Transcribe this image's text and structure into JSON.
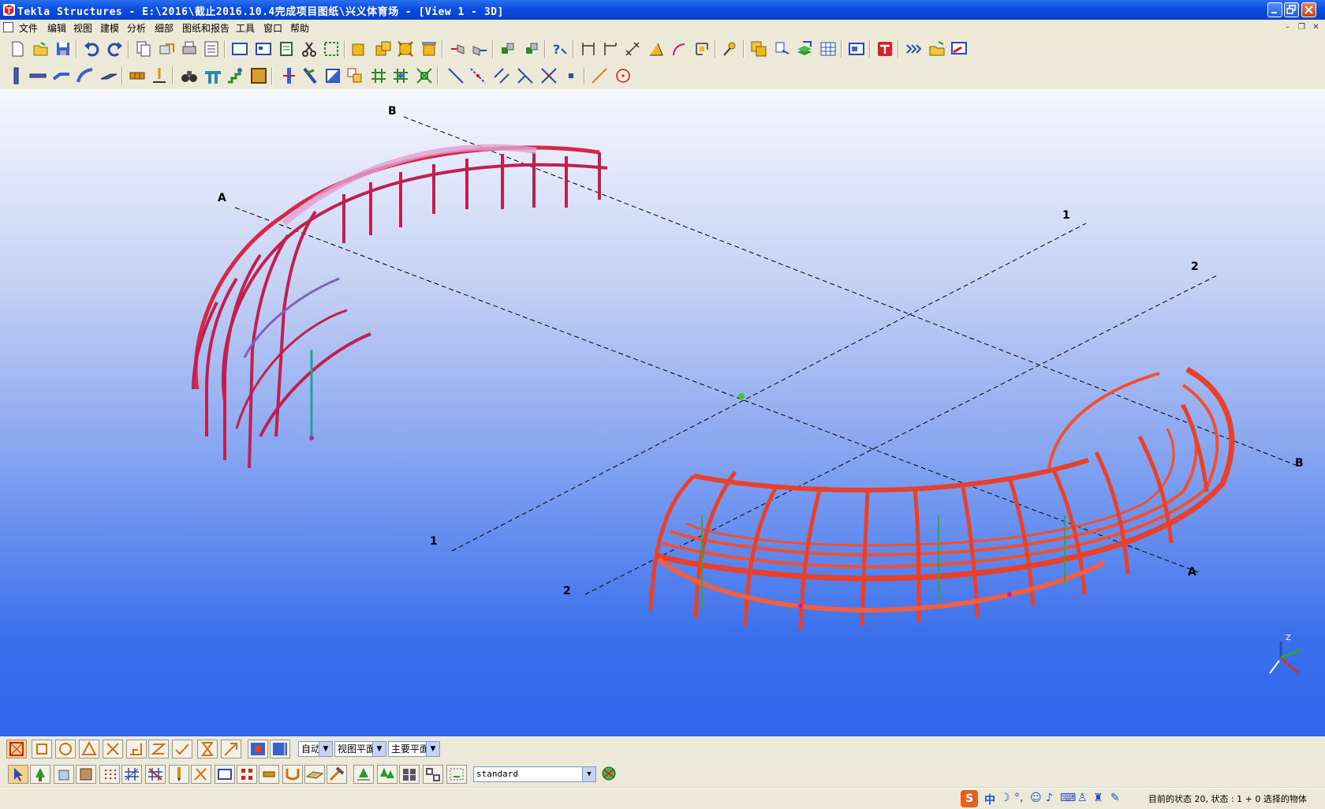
{
  "window": {
    "title": "Tekla Structures  - E:\\2016\\截止2016.10.4完成项目图纸\\兴义体育场  - [View 1 - 3D]"
  },
  "menu": {
    "items": [
      "文件",
      "编辑",
      "视图",
      "建模",
      "分析",
      "细部",
      "图纸和报告",
      "工具",
      "窗口",
      "帮助"
    ]
  },
  "viewport": {
    "grid_labels": {
      "A_left": "A",
      "A_right": "A",
      "B_top": "B",
      "B_right": "B",
      "one_top": "1",
      "one_bottom": "1",
      "two_top": "2",
      "two_bottom": "2"
    },
    "axis_z_label": "Z"
  },
  "bottom_toolbar": {
    "snap_mode": "自动",
    "plane_1": "视图平面",
    "plane_2": "主要平面",
    "standard": "standard"
  },
  "status": {
    "ime_chinese": "中",
    "text": "目前的状态 20, 状态 : 1 + 0 选择的物体"
  },
  "colors": {
    "title_bar": "#0a4ee0",
    "chrome": "#ece9d8",
    "structure_red": "#e8402a",
    "structure_pink": "#d080c0"
  }
}
